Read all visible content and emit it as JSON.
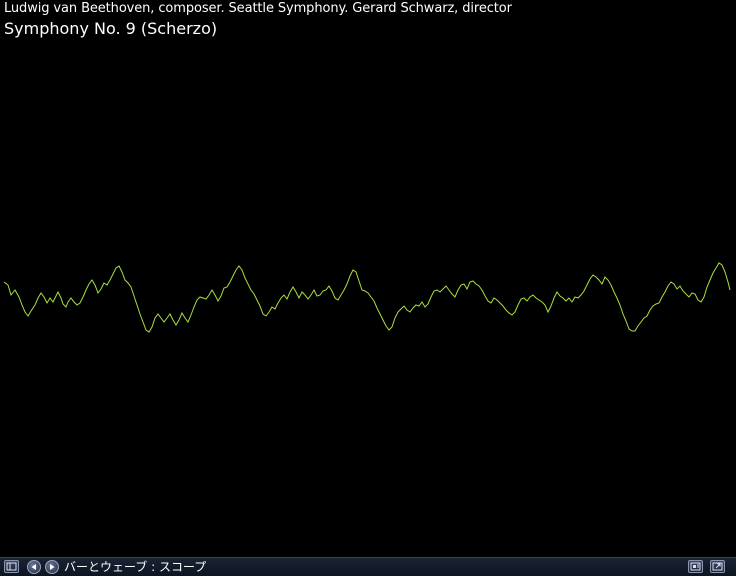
{
  "now_playing": {
    "artist_line": "Ludwig van Beethoven, composer. Seattle Symphony. Gerard Schwarz, director",
    "track_title": "Symphony No. 9 (Scherzo)"
  },
  "visualization": {
    "preset_name": "バーとウェーブ : スコープ",
    "wave_color": "#a8e040",
    "background_color": "#000000"
  },
  "statusbar": {
    "icons": [
      "now-playing-view-icon",
      "previous-preset-icon",
      "next-preset-icon",
      "compact-mode-icon",
      "full-screen-icon"
    ],
    "bar_color": "#131b2b"
  }
}
